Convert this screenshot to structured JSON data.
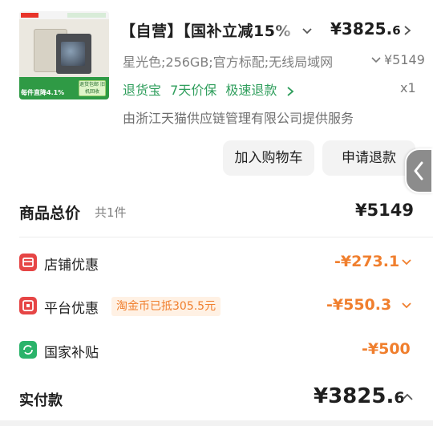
{
  "product": {
    "thumbnail_icon": "tablet-product-image",
    "thumbnail_banner_text": "每件直降4.1%",
    "thumbnail_badge_text": "退货包邮 旧机回收",
    "title": "【自营】【国补立减15%",
    "price_integer": "¥3825.",
    "price_decimal": "6",
    "spec": "星光色;256GB;官方标配;无线局域网",
    "original_price": "¥5149",
    "service_items": [
      "退货宝",
      "7天价保",
      "极速退款"
    ],
    "quantity": "x1",
    "provider": "由浙江天猫供应链管理有限公司提供服务"
  },
  "actions": {
    "add_to_cart": "加入购物车",
    "request_refund": "申请退款"
  },
  "summary": {
    "total_label": "商品总价",
    "count": "共1件",
    "total_value": "¥5149"
  },
  "discounts": {
    "shop": {
      "icon": "shop-icon",
      "label": "店铺优惠",
      "value": "-¥273.1"
    },
    "platform": {
      "icon": "platform-icon",
      "label": "平台优惠",
      "coin_tag": "淘金币已抵305.5元",
      "value": "-¥550.3"
    },
    "national": {
      "icon": "refresh-icon",
      "label": "国家补贴",
      "value": "-¥500"
    }
  },
  "payment": {
    "label": "实付款",
    "value_integer": "¥3825.",
    "value_decimal": "6"
  },
  "colors": {
    "accent_orange": "#f07f2e",
    "service_green": "#2f9e5c",
    "icon_red": "#e64545",
    "icon_green": "#2ab36a"
  }
}
